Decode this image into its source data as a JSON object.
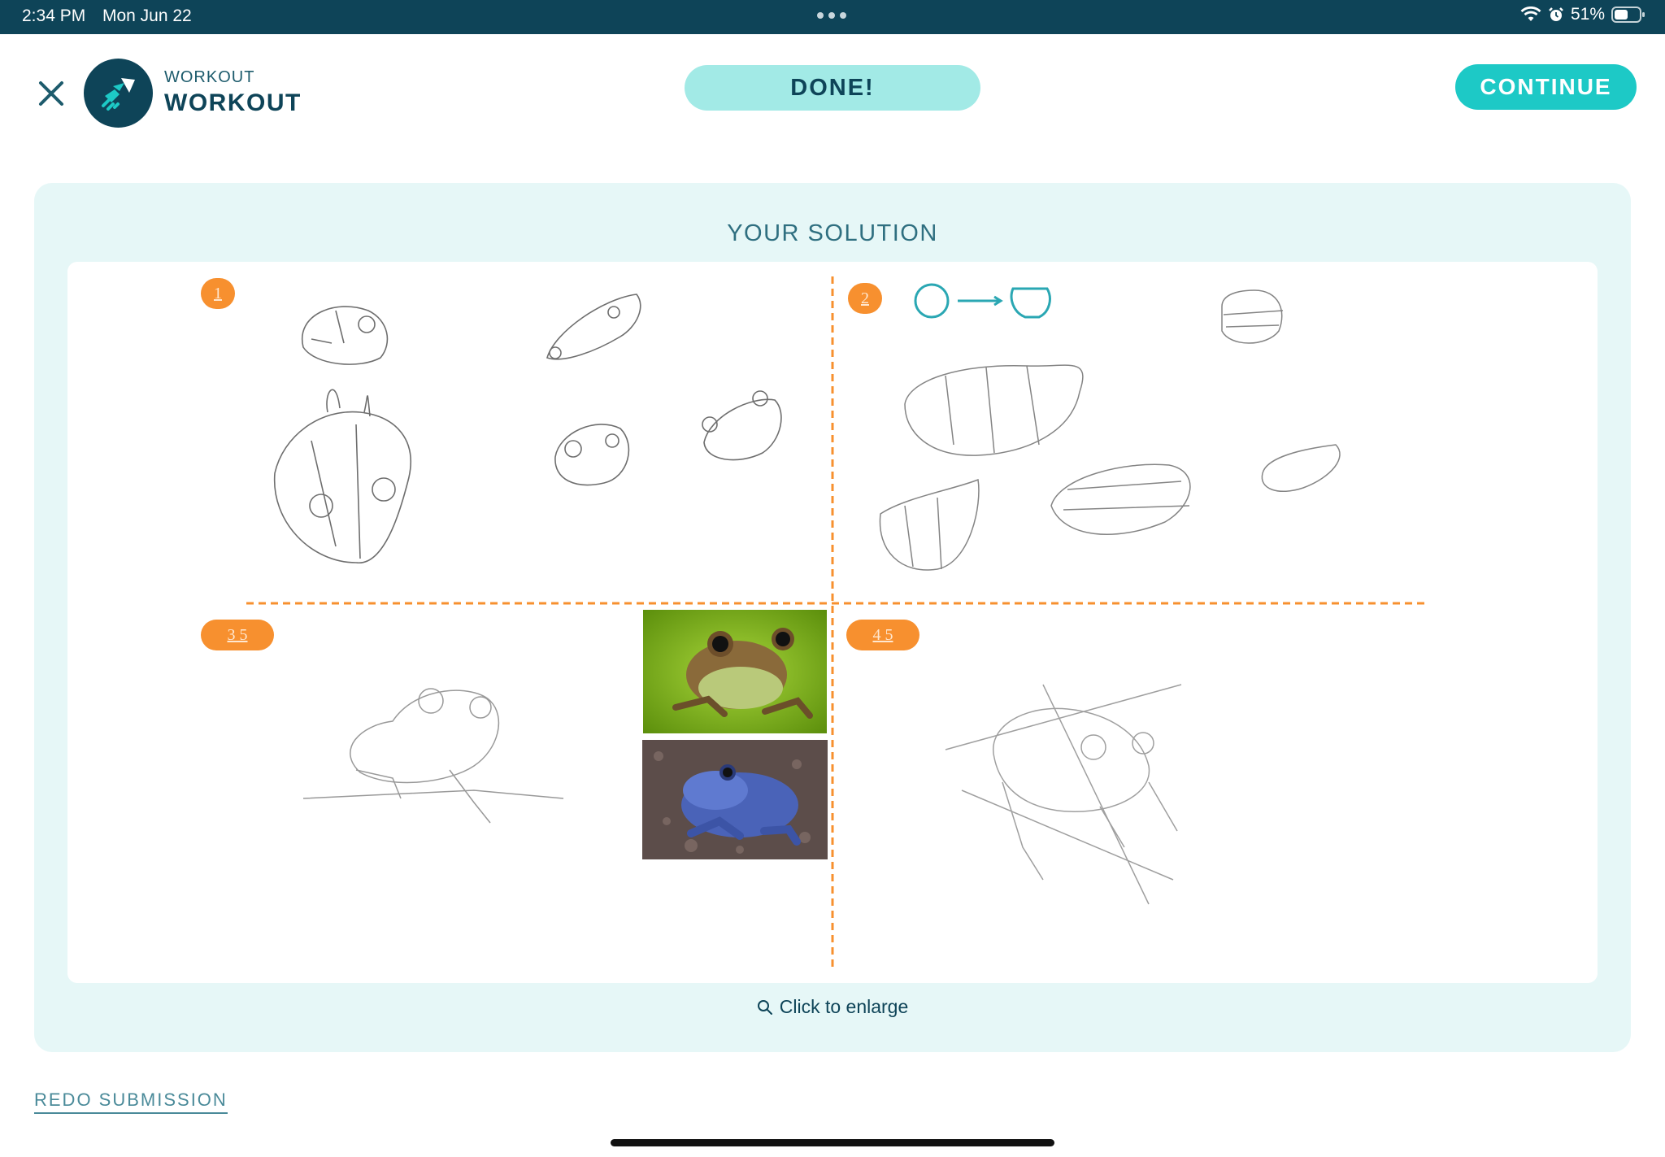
{
  "status_bar": {
    "time": "2:34 PM",
    "date": "Mon Jun 22",
    "battery": "51%"
  },
  "header": {
    "subtitle": "WORKOUT",
    "title": "WORKOUT",
    "done_label": "DONE!",
    "continue_label": "CONTINUE"
  },
  "solution": {
    "heading": "YOUR SOLUTION",
    "enlarge_label": "Click to enlarge",
    "badges": [
      "1",
      "2",
      "3 5",
      "4 5"
    ]
  },
  "footer": {
    "redo_label": "REDO SUBMISSION"
  },
  "colors": {
    "status_bar": "#0e4458",
    "accent": "#1dc9c6",
    "done_pill": "#a2eae6",
    "card_bg": "#e6f7f7",
    "badge": "#f7902f",
    "guide_line": "#f7902f"
  }
}
